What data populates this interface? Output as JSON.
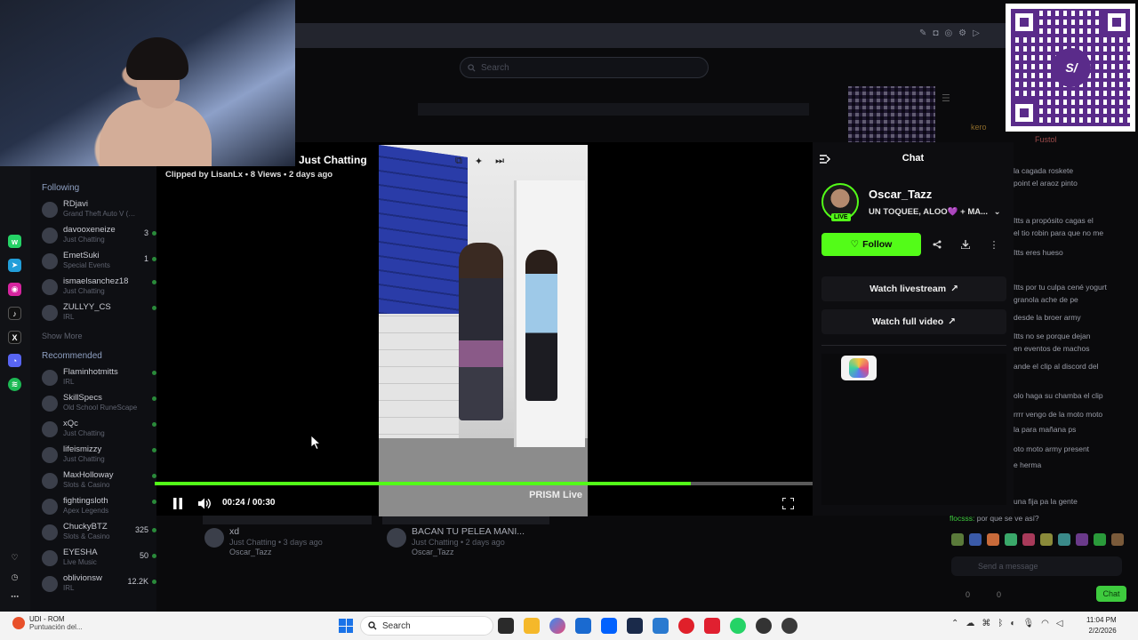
{
  "background": {
    "search_placeholder": "Search",
    "sidebar": {
      "following_heading": "Following",
      "following": [
        {
          "name": "RDjavi",
          "sub": "Grand Theft Auto V (…",
          "count": "",
          "live": false
        },
        {
          "name": "davooxeneize",
          "sub": "Just Chatting",
          "count": "3",
          "live": true
        },
        {
          "name": "EmetSuki",
          "sub": "Special Events",
          "count": "1",
          "live": true
        },
        {
          "name": "ismaelsanchez18",
          "sub": "Just Chatting",
          "count": "",
          "live": true
        },
        {
          "name": "ZULLYY_CS",
          "sub": "IRL",
          "count": "",
          "live": true
        }
      ],
      "show_more": "Show More",
      "recommended_heading": "Recommended",
      "recommended": [
        {
          "name": "Flaminhotmitts",
          "sub": "IRL",
          "count": "",
          "live": true
        },
        {
          "name": "SkillSpecs",
          "sub": "Old School RuneScape",
          "count": "",
          "live": true
        },
        {
          "name": "xQc",
          "sub": "Just Chatting",
          "count": "",
          "live": true
        },
        {
          "name": "lifeismizzy",
          "sub": "Just Chatting",
          "count": "",
          "live": true
        },
        {
          "name": "MaxHolloway",
          "sub": "Slots & Casino",
          "count": "",
          "live": true
        },
        {
          "name": "fightingsloth",
          "sub": "Apex Legends",
          "count": "",
          "live": true
        },
        {
          "name": "ChuckyBTZ",
          "sub": "Slots & Casino",
          "count": "325",
          "live": true
        },
        {
          "name": "EYESHA",
          "sub": "Live Music",
          "count": "50",
          "live": true
        },
        {
          "name": "oblivionsw",
          "sub": "IRL",
          "count": "12.2K",
          "live": true
        }
      ]
    },
    "clip_cards": [
      {
        "title": "xd",
        "sub": "Just Chatting • 3 days ago",
        "channel": "Oscar_Tazz"
      },
      {
        "title": "BACAN TU PELEA MANI...",
        "sub": "Just Chatting • 2 days ago",
        "channel": "Oscar_Tazz"
      }
    ],
    "chat_lines": [
      "la cagada roskete",
      "point el araoz pinto",
      "Itts a propósito cagas el",
      "el tio robin para que no me",
      "Itts eres hueso",
      "Itts por tu culpa cené yogurt",
      "granola ache de pe",
      "desde la broer army",
      "Itts no se porque dejan",
      "en eventos de machos",
      "ande el clip al discord del",
      "olo haga su chamba el clip",
      "rrrr vengo de la moto moto",
      "la para mañana ps",
      "oto moto army present",
      "e herma",
      "una fija pa la gente"
    ],
    "chat_last_user": "flocsss:",
    "chat_last_msg": "por que se ve así?",
    "chat_input_placeholder": "Send a message",
    "chat_send_label": "Chat",
    "chat_counts": [
      "0",
      "0"
    ],
    "chat_top_users": [
      "kero",
      "Fustol"
    ]
  },
  "clip": {
    "category": "Just Chatting",
    "meta": "Clipped by LisanLx • 8 Views • 2 days ago",
    "time": "00:24 / 00:30",
    "progress": 0.815,
    "watermark": "PRISM Live"
  },
  "panel": {
    "title": "Chat",
    "streamer": "Oscar_Tazz",
    "live_badge": "LIVE",
    "stream_title": "UN TOQUEE, ALOO💜 + MA...",
    "follow_label": "Follow",
    "watch_livestream": "Watch livestream",
    "watch_full_video": "Watch full video"
  },
  "taskbar": {
    "weather_title": "UDI - ROM",
    "weather_sub": "Puntuación del...",
    "search_label": "Search",
    "time": "11:04 PM",
    "date": "2/2/2026"
  },
  "colors": {
    "accent": "#53fc18"
  }
}
